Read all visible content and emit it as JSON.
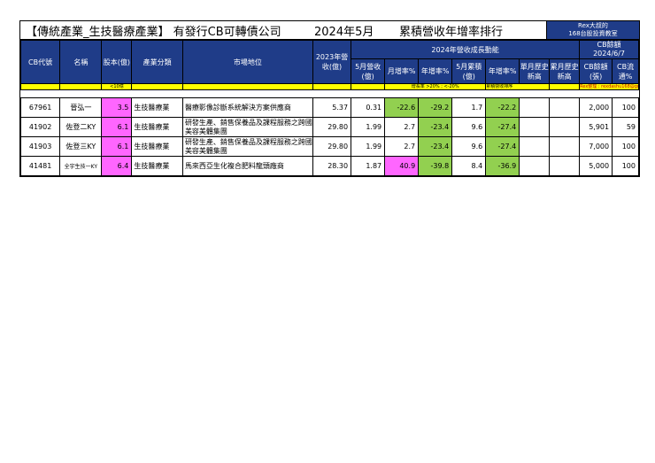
{
  "title": {
    "part1": "【傳統產業_生技醫療產業】 有發行CB可轉債公司",
    "part2": "2024年5月",
    "part3": "累積營收年增率排行",
    "rex_line1": "Rex大叔的",
    "rex_line2": "168台股投資教室"
  },
  "headers": {
    "code": "CB代號",
    "name": "名稱",
    "capital": "股本(億)",
    "industry": "產業分類",
    "position": "市場地位",
    "rev2023": "2023年營收(億)",
    "group_growth": "2024年營收成長動能",
    "may_rev": "5月營收(億)",
    "mom": "月增率%",
    "yoy": "年增率%",
    "may_cum": "5月累積(億)",
    "cum_yoy": "年增率%",
    "month_high": "單月歷史新高",
    "cum_high": "累月歷史新高",
    "cb_balance_title": "CB餘額",
    "cb_date": "2024/6/7",
    "cb_balance": "CB餘額(張)",
    "cb_float": "CB流通%"
  },
  "notes": {
    "capital": "<10億",
    "growth": "增長率 >20% ; <-20%",
    "cum": "累積營收排序",
    "rex": "Rex整理 : rexdashu168@gmail.com"
  },
  "rows": [
    {
      "code": "67961",
      "name": "晉弘一",
      "capital": "3.5",
      "industry": "生技醫療業",
      "position": "醫療影像診斷系統解決方案供應商",
      "rev2023": "5.37",
      "may_rev": "0.31",
      "mom": "-22.6",
      "yoy": "-29.2",
      "may_cum": "1.7",
      "cum_yoy": "-22.2",
      "month_high": "",
      "cum_high": "",
      "cb_balance": "2,000",
      "cb_float": "100"
    },
    {
      "code": "41902",
      "name": "佐登二KY",
      "capital": "6.1",
      "industry": "生技醫療業",
      "position": "研發生產、銷售保養品及課程服務之跨國美容美體集團",
      "rev2023": "29.80",
      "may_rev": "1.99",
      "mom": "2.7",
      "yoy": "-23.4",
      "may_cum": "9.6",
      "cum_yoy": "-27.4",
      "month_high": "",
      "cum_high": "",
      "cb_balance": "5,901",
      "cb_float": "59"
    },
    {
      "code": "41903",
      "name": "佐登三KY",
      "capital": "6.1",
      "industry": "生技醫療業",
      "position": "研發生產、銷售保養品及課程服務之跨國美容美體集團",
      "rev2023": "29.80",
      "may_rev": "1.99",
      "mom": "2.7",
      "yoy": "-23.4",
      "may_cum": "9.6",
      "cum_yoy": "-27.4",
      "month_high": "",
      "cum_high": "",
      "cb_balance": "7,000",
      "cb_float": "100"
    },
    {
      "code": "41481",
      "name": "全宇生技一KY",
      "capital": "6.4",
      "industry": "生技醫療業",
      "position": "馬來西亞生化複合肥料龍頭廠商",
      "rev2023": "28.30",
      "may_rev": "1.87",
      "mom": "40.9",
      "yoy": "-39.8",
      "may_cum": "8.4",
      "cum_yoy": "-36.9",
      "month_high": "",
      "cum_high": "",
      "cb_balance": "5,000",
      "cb_float": "100"
    }
  ],
  "highlights": {
    "pink": "#ff66ff",
    "green": "#92d050",
    "header_blue": "#1f3c88",
    "note_yellow": "#ffff00"
  }
}
